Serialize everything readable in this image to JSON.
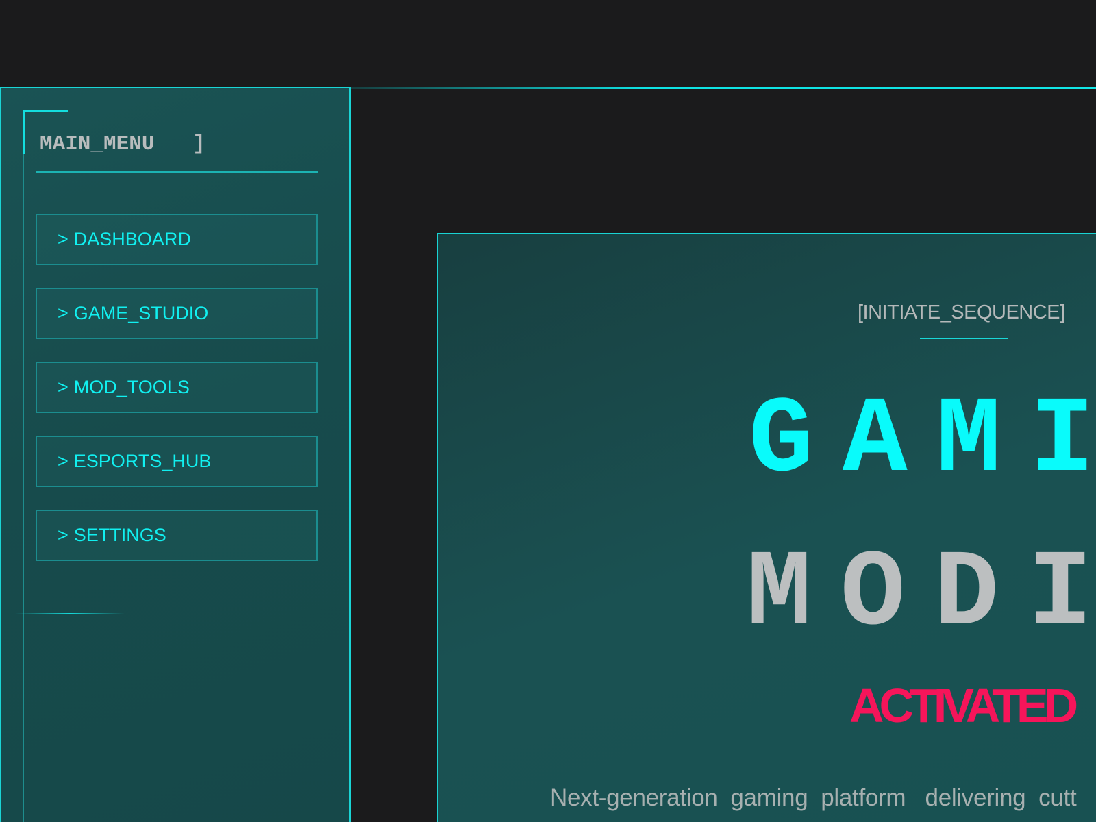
{
  "sidebar": {
    "title": "MAIN_MENU",
    "title_bracket_close": "]",
    "items": [
      {
        "arrow": ">",
        "label": "DASHBOARD"
      },
      {
        "arrow": ">",
        "label": "GAME_STUDIO"
      },
      {
        "arrow": ">",
        "label": "MOD_TOOLS"
      },
      {
        "arrow": ">",
        "label": "ESPORTS_HUB"
      },
      {
        "arrow": ">",
        "label": "SETTINGS"
      }
    ]
  },
  "hero": {
    "kicker": "[INITIATE_SEQUENCE]",
    "line1": "GAMI",
    "line2": "MODI",
    "status": "ACTIVATED",
    "tagline": "Next-generation  gaming  platform   delivering  cutt"
  },
  "colors": {
    "background": "#1b1b1c",
    "accent_cyan": "#09fbfb",
    "panel_teal": "#184d4e",
    "alert_pink": "#f5155a",
    "text_gray": "#b8bcbd"
  }
}
